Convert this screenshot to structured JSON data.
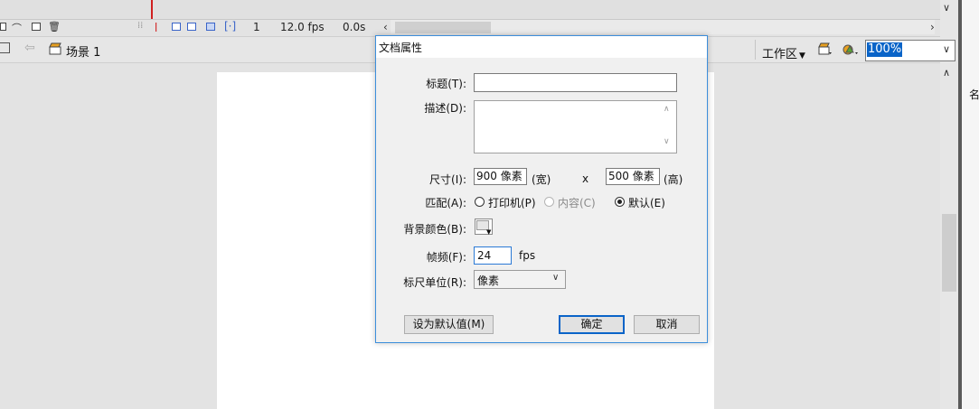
{
  "timeline": {
    "frame_number": "1",
    "frame_rate": "12.0 fps",
    "elapsed_time": "0.0s"
  },
  "editbar": {
    "scene_name": "场景 1",
    "workspace_label": "工作区",
    "workspace_arrow": "▼",
    "zoom_value": "100%"
  },
  "right_panel": {
    "label": "名"
  },
  "dialog": {
    "title": "文档属性",
    "labels": {
      "title": "标题(T):",
      "description": "描述(D):",
      "dimensions": "尺寸(I):",
      "match": "匹配(A):",
      "background": "背景颜色(B):",
      "frame_rate": "帧频(F):",
      "ruler_units": "标尺单位(R):"
    },
    "fields": {
      "title_value": "",
      "description_value": "",
      "width_value": "900 像素",
      "width_suffix": "(宽)",
      "times": "x",
      "height_value": "500 像素",
      "height_suffix": "(高)",
      "fps_value": "24",
      "fps_unit": "fps",
      "ruler_unit_selected": "像素"
    },
    "match_options": [
      {
        "label": "打印机(P)",
        "selected": false,
        "disabled": false
      },
      {
        "label": "内容(C)",
        "selected": false,
        "disabled": true
      },
      {
        "label": "默认(E)",
        "selected": true,
        "disabled": false
      }
    ],
    "buttons": {
      "make_default": "设为默认值(M)",
      "ok": "确定",
      "cancel": "取消"
    }
  },
  "colors": {
    "accent": "#3c8edb",
    "selection": "#0a64c8",
    "playhead": "#d02020",
    "stage": "#ffffff",
    "background": "#e3e3e3"
  }
}
